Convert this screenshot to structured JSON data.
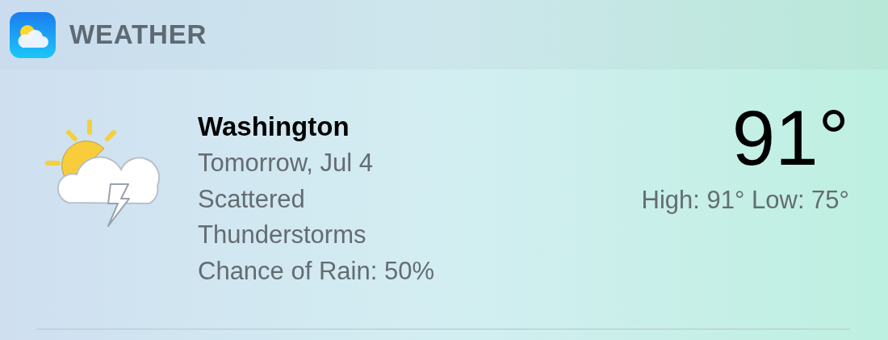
{
  "widget": {
    "title": "WEATHER"
  },
  "forecast": {
    "city": "Washington",
    "lines": [
      "Tomorrow, Jul 4",
      "Scattered",
      "Thunderstorms",
      "Chance of Rain: 50%"
    ],
    "temperature": "91°",
    "high_low": "High: 91° Low: 75°"
  }
}
